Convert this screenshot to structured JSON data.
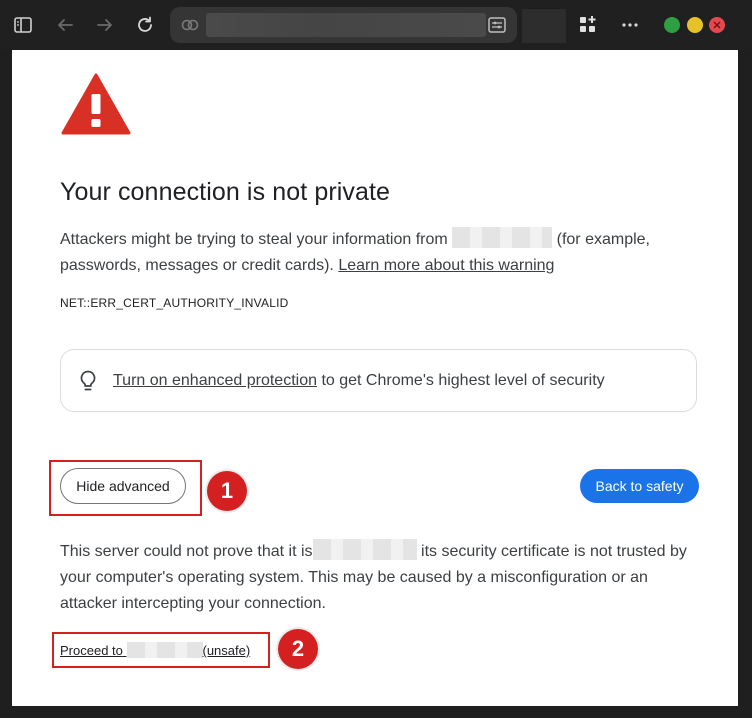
{
  "browser": {
    "address_blurred": "",
    "colors": {
      "close": "#e5484d",
      "minimize": "#2ea043",
      "maximize": "#e6c229"
    }
  },
  "page": {
    "title": "Your connection is not private",
    "intro_before": "Attackers might be trying to steal your information from",
    "intro_after": "(for example, passwords, messages or credit cards).",
    "learn_more_link": "Learn more about this warning",
    "error_code": "NET::ERR_CERT_AUTHORITY_INVALID",
    "promo": {
      "link": "Turn on enhanced protection",
      "text": " to get Chrome's highest level of security"
    },
    "hide_advanced_button": "Hide advanced",
    "back_to_safety_button": "Back to safety",
    "details_before": "This server could not prove that it is",
    "details_after": "its security certificate is not trusted by your computer's operating system. This may be caused by a misconfiguration or an attacker intercepting your connection.",
    "proceed_prefix": "Proceed to",
    "proceed_suffix": "(unsafe)",
    "accent_color": "#1a73e8",
    "warning_color": "#d93025"
  },
  "annotations": {
    "badge_1": "1",
    "badge_2": "2",
    "color": "#d42020"
  }
}
